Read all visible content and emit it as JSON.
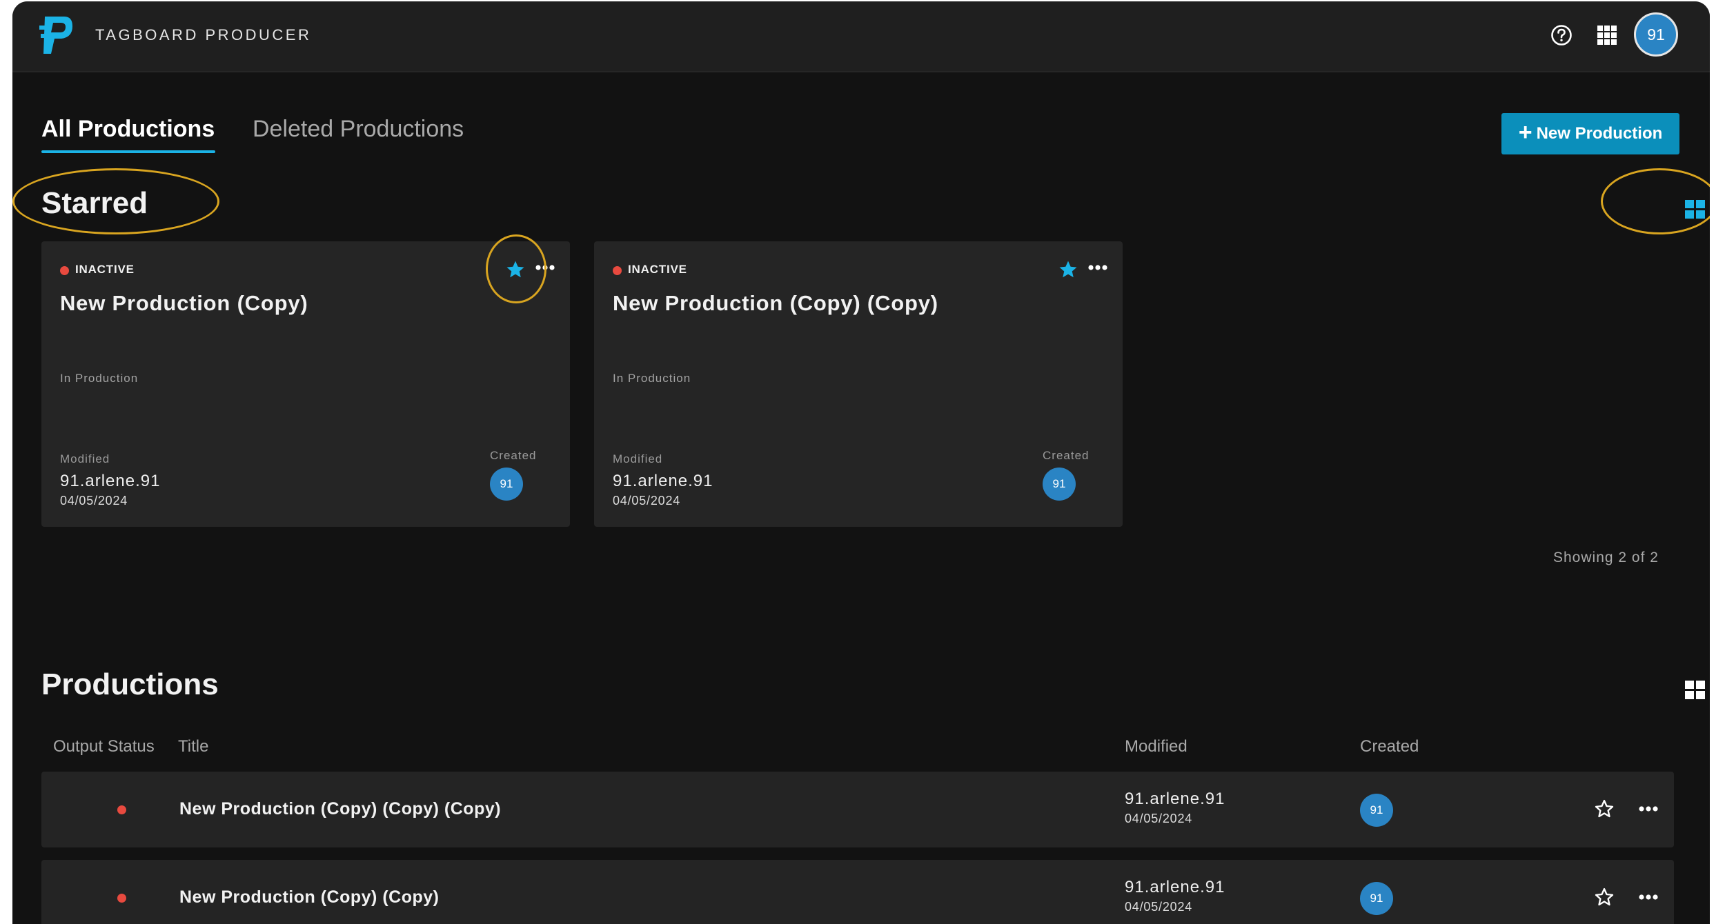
{
  "app": {
    "title": "TAGBOARD PRODUCER",
    "user_initials": "91"
  },
  "tabs": [
    {
      "label": "All Productions",
      "active": true
    },
    {
      "label": "Deleted Productions",
      "active": false
    }
  ],
  "new_production_label": "New Production",
  "starred": {
    "title": "Starred",
    "view_mode": "grid",
    "cards": [
      {
        "status": "INACTIVE",
        "title": "New Production (Copy)",
        "state": "In Production",
        "modified_label": "Modified",
        "modified_user": "91.arlene.91",
        "modified_date": "04/05/2024",
        "created_label": "Created",
        "created_initials": "91",
        "starred": true
      },
      {
        "status": "INACTIVE",
        "title": "New Production (Copy) (Copy)",
        "state": "In Production",
        "modified_label": "Modified",
        "modified_user": "91.arlene.91",
        "modified_date": "04/05/2024",
        "created_label": "Created",
        "created_initials": "91",
        "starred": true
      }
    ],
    "showing": "Showing 2 of 2"
  },
  "productions": {
    "title": "Productions",
    "view_mode": "list",
    "columns": [
      "Output Status",
      "Title",
      "Modified",
      "Created"
    ],
    "rows": [
      {
        "title": "New Production (Copy) (Copy) (Copy)",
        "modified_user": "91.arlene.91",
        "modified_date": "04/05/2024",
        "created_initials": "91",
        "starred": false
      },
      {
        "title": "New Production (Copy) (Copy)",
        "modified_user": "91.arlene.91",
        "modified_date": "04/05/2024",
        "created_initials": "91",
        "starred": false
      }
    ]
  },
  "colors": {
    "accent": "#1bb3e6",
    "button": "#0b8fbb",
    "inactive": "#e84a3f",
    "avatar": "#2a84c4",
    "highlight": "#d9a520"
  }
}
